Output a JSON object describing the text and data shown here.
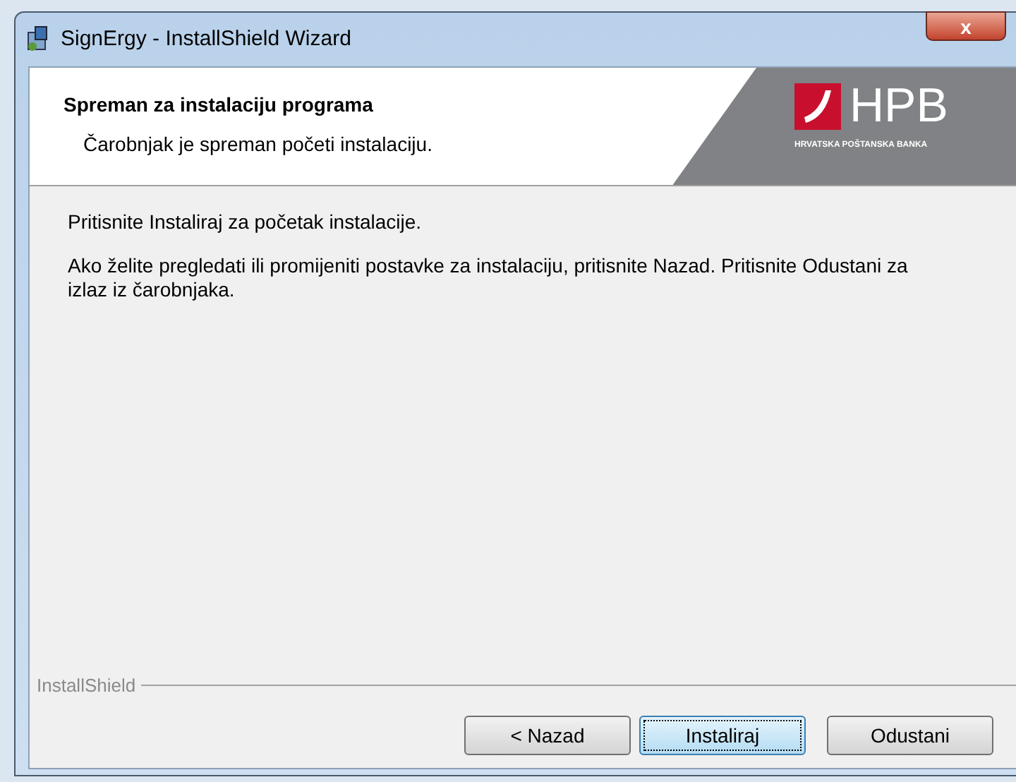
{
  "window": {
    "title": "SignErgy - InstallShield Wizard",
    "close": "x"
  },
  "header": {
    "title": "Spreman za instalaciju programa",
    "subtitle": "Čarobnjak je spreman početi instalaciju.",
    "logo": {
      "text": "HPB",
      "tagline": "HRVATSKA POŠTANSKA BANKA"
    }
  },
  "body": [
    "Pritisnite Instaliraj za početak instalacije.",
    "Ako želite pregledati ili promijeniti postavke za instalaciju, pritisnite Nazad. Pritisnite Odustani za izlaz iz čarobnjaka."
  ],
  "brand": "InstallShield",
  "buttons": [
    {
      "label": "< Nazad",
      "default": false
    },
    {
      "label": "Instaliraj",
      "default": true
    },
    {
      "label": "Odustani",
      "default": false
    }
  ]
}
